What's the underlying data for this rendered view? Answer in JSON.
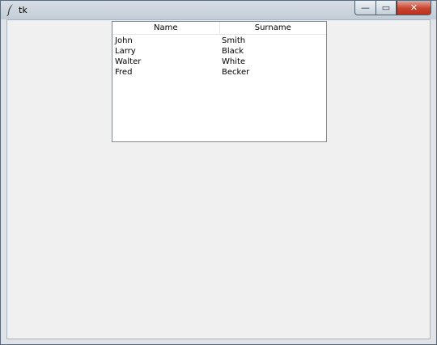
{
  "window": {
    "title": "tk",
    "minimize_glyph": "—",
    "maximize_glyph": "▭",
    "close_glyph": "✕"
  },
  "table": {
    "columns": [
      "Name",
      "Surname"
    ],
    "rows": [
      [
        "John",
        "Smith"
      ],
      [
        "Larry",
        "Black"
      ],
      [
        "Walter",
        "White"
      ],
      [
        "Fred",
        "Becker"
      ]
    ]
  },
  "colors": {
    "client_bg": "#f0f0f0",
    "close_button": "#c9432e"
  },
  "icons": {
    "app": "tk-feather-icon"
  }
}
